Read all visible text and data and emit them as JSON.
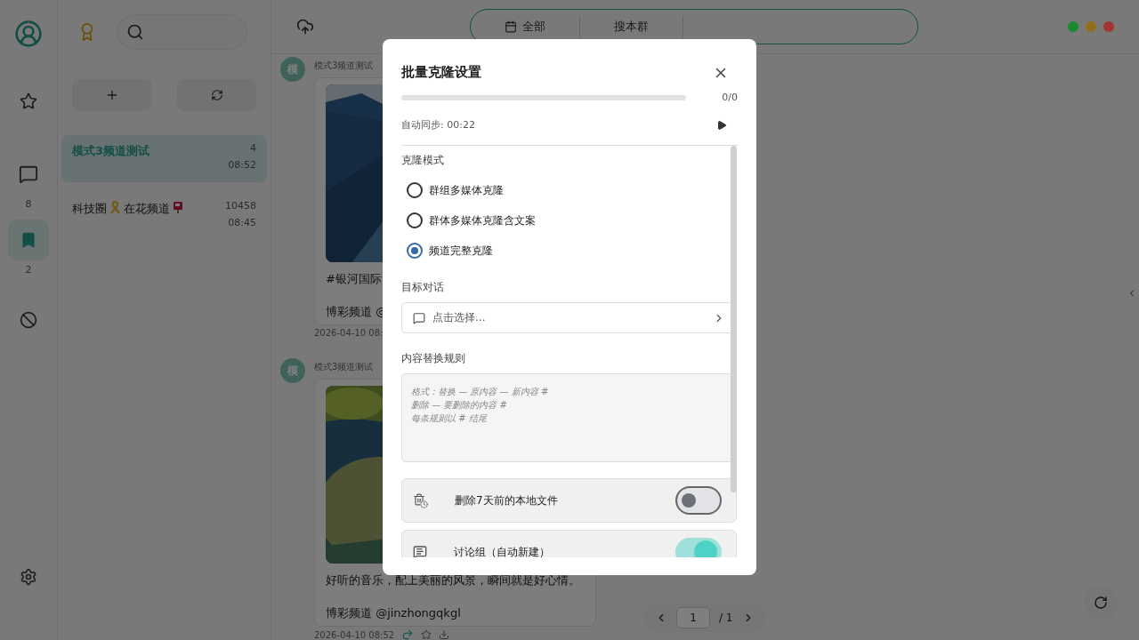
{
  "rail": {
    "items": [
      {
        "kind": "profile",
        "selected": false
      },
      {
        "kind": "star",
        "selected": false
      },
      {
        "kind": "chat",
        "badge": "8",
        "selected": false
      },
      {
        "kind": "bookmark",
        "badge": "2",
        "selected": true
      },
      {
        "kind": "block",
        "selected": false
      },
      {
        "kind": "settings",
        "selected": false
      }
    ]
  },
  "chat_list": {
    "items": [
      {
        "title_parts": [
          "模式3频道测试"
        ],
        "count": "4",
        "time": "08:52",
        "selected": true
      },
      {
        "title_parts": [
          "科技圈",
          "在花频道"
        ],
        "count": "10458",
        "time": "08:45",
        "selected": false
      }
    ]
  },
  "toolbar": {
    "scope": "全部",
    "search_scope": "搜本群"
  },
  "window_controls": [
    {
      "color": "#1a8a2c"
    },
    {
      "color": "#8f6e1c"
    },
    {
      "color": "#a33434"
    }
  ],
  "messages": [
    {
      "avatar": "模",
      "sender": "模式3频道测试",
      "paragraphs": [
        "#银河国际",
        "博彩频道 @"
      ],
      "timestamp": "2026-04-10 08:",
      "actions_visible": false
    },
    {
      "avatar": "模",
      "sender": "模式3频道测试",
      "paragraphs": [
        "好听的音乐，配上美丽的风景，瞬间就是好心情。",
        "博彩频道 @jinzhongqkgl"
      ],
      "timestamp": "2026-04-10 08:52",
      "actions_visible": true
    }
  ],
  "pagination": {
    "page": "1",
    "total": "/ 1"
  },
  "dialog": {
    "title": "批量克隆设置",
    "progress": {
      "level": 0,
      "text": "0/0"
    },
    "auto_sync": "自动同步: 00:22",
    "clone_mode": {
      "label": "克隆模式",
      "options": [
        {
          "label": "群组多媒体克隆",
          "selected": false
        },
        {
          "label": "群体多媒体克隆含文案",
          "selected": false
        },
        {
          "label": "频道完整克隆",
          "selected": true
        }
      ]
    },
    "target": {
      "label": "目标对话",
      "placeholder": "点击选择..."
    },
    "rules": {
      "label": "内容替换规则",
      "placeholder": "格式：替换 — 原内容 — 新内容 #\n删除 — 要删除的内容 #\n每条规则以 # 结尾"
    },
    "toggles": [
      {
        "kind": "cleanup",
        "label": "删除7天前的本地文件",
        "on": false
      },
      {
        "kind": "discussion",
        "label": "讨论组（自动新建）",
        "on": true
      }
    ]
  }
}
